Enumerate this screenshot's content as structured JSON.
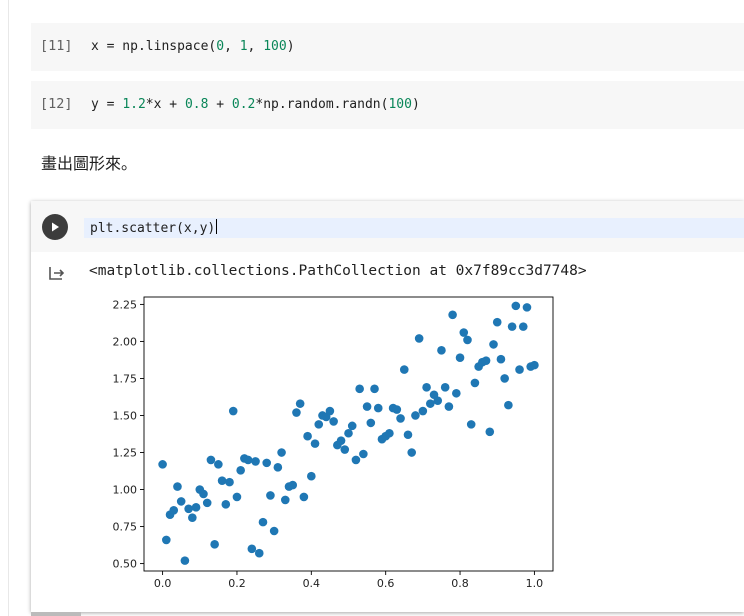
{
  "cells": [
    {
      "exec_label": "[11]",
      "code": [
        {
          "t": "x = np.linspace(",
          "c": ""
        },
        {
          "t": "0",
          "c": "num"
        },
        {
          "t": ", ",
          "c": ""
        },
        {
          "t": "1",
          "c": "num"
        },
        {
          "t": ", ",
          "c": ""
        },
        {
          "t": "100",
          "c": "num"
        },
        {
          "t": ")",
          "c": ""
        }
      ]
    },
    {
      "exec_label": "[12]",
      "code": [
        {
          "t": "y = ",
          "c": ""
        },
        {
          "t": "1.2",
          "c": "num"
        },
        {
          "t": "*x + ",
          "c": ""
        },
        {
          "t": "0.8",
          "c": "num"
        },
        {
          "t": " + ",
          "c": ""
        },
        {
          "t": "0.2",
          "c": "num"
        },
        {
          "t": "*np.random.randn(",
          "c": ""
        },
        {
          "t": "100",
          "c": "num"
        },
        {
          "t": ")",
          "c": ""
        }
      ]
    }
  ],
  "markdown_text": "畫出圖形來。",
  "active_cell": {
    "code": "plt.scatter(x,y)",
    "run_icon": "play-icon",
    "output_icon": "output-redirect-icon",
    "output_text": "<matplotlib.collections.PathCollection at 0x7f89cc3d7748>"
  },
  "colors": {
    "number": "#098658",
    "marker": "#1f77b4",
    "cell_bg": "#f7f7f7",
    "active_line": "#e8f0fe"
  },
  "chart_data": {
    "type": "scatter",
    "xlim": [
      -0.05,
      1.05
    ],
    "ylim": [
      0.45,
      2.3
    ],
    "xticks": [
      0.0,
      0.2,
      0.4,
      0.6,
      0.8,
      1.0
    ],
    "yticks": [
      0.5,
      0.75,
      1.0,
      1.25,
      1.5,
      1.75,
      2.0,
      2.25
    ],
    "xtick_labels": [
      "0.0",
      "0.2",
      "0.4",
      "0.6",
      "0.8",
      "1.0"
    ],
    "ytick_labels": [
      "0.50",
      "0.75",
      "1.00",
      "1.25",
      "1.50",
      "1.75",
      "2.00",
      "2.25"
    ],
    "grid": false,
    "color": "#1f77b4",
    "x": [
      0.0,
      0.01,
      0.02,
      0.03,
      0.04,
      0.05,
      0.06,
      0.07,
      0.08,
      0.09,
      0.1,
      0.11,
      0.12,
      0.13,
      0.14,
      0.15,
      0.16,
      0.17,
      0.18,
      0.19,
      0.2,
      0.21,
      0.22,
      0.23,
      0.24,
      0.25,
      0.26,
      0.27,
      0.28,
      0.29,
      0.3,
      0.31,
      0.32,
      0.33,
      0.34,
      0.35,
      0.36,
      0.37,
      0.38,
      0.39,
      0.4,
      0.41,
      0.42,
      0.43,
      0.44,
      0.45,
      0.46,
      0.47,
      0.48,
      0.49,
      0.5,
      0.51,
      0.52,
      0.53,
      0.54,
      0.55,
      0.56,
      0.57,
      0.58,
      0.59,
      0.6,
      0.61,
      0.62,
      0.63,
      0.64,
      0.65,
      0.66,
      0.67,
      0.68,
      0.69,
      0.7,
      0.71,
      0.72,
      0.73,
      0.74,
      0.75,
      0.76,
      0.77,
      0.78,
      0.79,
      0.8,
      0.81,
      0.82,
      0.83,
      0.84,
      0.85,
      0.86,
      0.87,
      0.88,
      0.89,
      0.9,
      0.91,
      0.92,
      0.93,
      0.94,
      0.95,
      0.96,
      0.97,
      0.98,
      0.99,
      1.0
    ],
    "y": [
      1.17,
      0.66,
      0.83,
      0.86,
      1.02,
      0.92,
      0.52,
      0.87,
      0.81,
      0.88,
      1.0,
      0.97,
      0.91,
      1.2,
      0.63,
      1.17,
      1.06,
      0.9,
      1.05,
      1.53,
      0.95,
      1.13,
      1.21,
      1.2,
      0.6,
      1.19,
      0.57,
      0.78,
      1.18,
      0.96,
      0.72,
      1.15,
      1.25,
      0.93,
      1.02,
      1.03,
      1.52,
      1.58,
      0.95,
      1.36,
      1.09,
      1.31,
      1.44,
      1.5,
      1.49,
      1.53,
      1.46,
      1.3,
      1.33,
      1.27,
      1.38,
      1.43,
      1.2,
      1.68,
      1.24,
      1.56,
      1.45,
      1.68,
      1.55,
      1.34,
      1.36,
      1.38,
      1.55,
      1.54,
      1.48,
      1.81,
      1.37,
      1.25,
      1.5,
      2.02,
      1.53,
      1.69,
      1.58,
      1.64,
      1.6,
      1.94,
      1.69,
      1.56,
      2.18,
      1.65,
      1.89,
      2.06,
      2.01,
      1.44,
      1.72,
      1.83,
      1.86,
      1.87,
      1.39,
      1.98,
      2.13,
      1.88,
      1.75,
      1.57,
      2.1,
      2.24,
      1.81,
      2.1,
      2.23,
      1.83,
      1.84
    ]
  }
}
